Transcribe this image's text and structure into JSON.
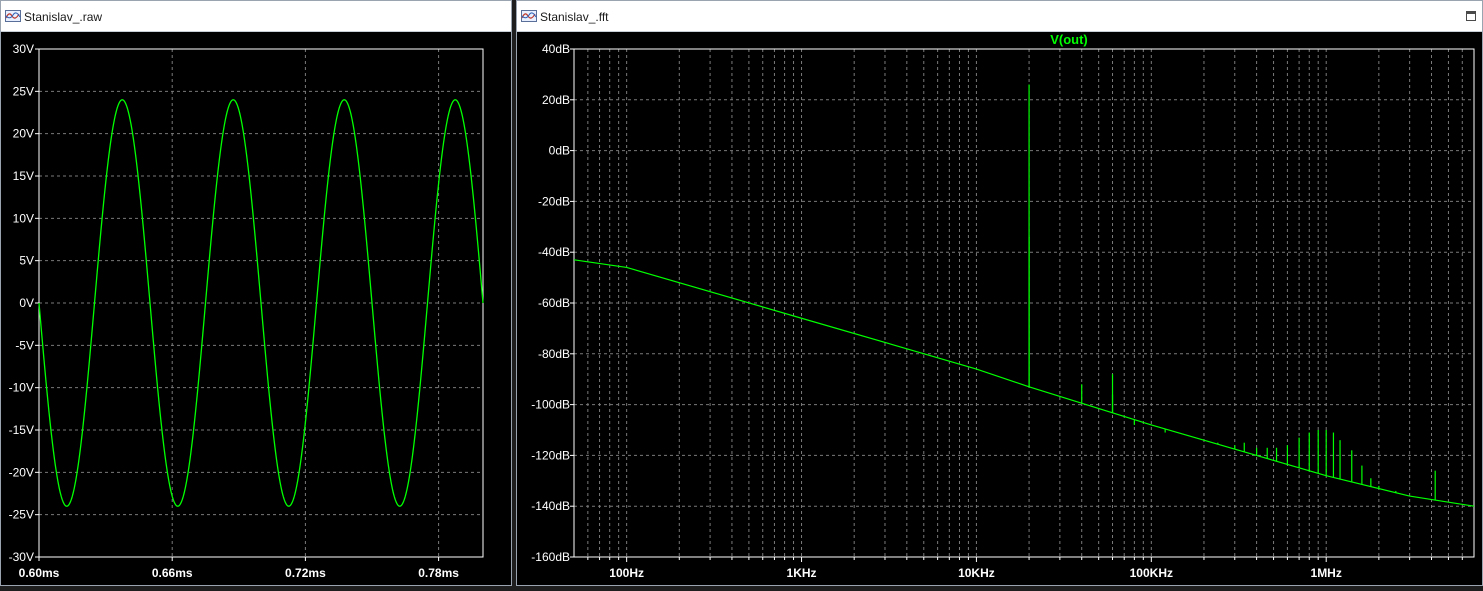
{
  "windows": {
    "left": {
      "title": "Stanislav_.raw"
    },
    "right": {
      "title": "Stanislav_.fft"
    }
  },
  "colors": {
    "trace": "#00ff00",
    "title_trace": "#00ff00",
    "axis_text": "#ffffff",
    "grid": "#7a7a7a",
    "background": "#000000"
  },
  "icons": {
    "window": "waveform-icon",
    "right_button": "maximize-icon"
  },
  "chart_data": [
    {
      "type": "line",
      "title": "",
      "xlabel": "",
      "ylabel": "",
      "xlim": [
        0.6,
        0.8
      ],
      "ylim": [
        -30,
        30
      ],
      "grid": true,
      "x_ticks": [
        0.6,
        0.66,
        0.72,
        0.78
      ],
      "x_tick_labels": [
        "0.60ms",
        "0.66ms",
        "0.72ms",
        "0.78ms"
      ],
      "y_ticks": [
        30,
        25,
        20,
        15,
        10,
        5,
        0,
        -5,
        -10,
        -15,
        -20,
        -25,
        -30
      ],
      "y_tick_labels": [
        "30V",
        "25V",
        "20V",
        "15V",
        "10V",
        "5V",
        "0V",
        "-5V",
        "-10V",
        "-15V",
        "-20V",
        "-25V",
        "-30V"
      ],
      "series": [
        {
          "amplitude": 24,
          "frequency_khz": 20,
          "phase_at_0_60ms": 0,
          "x_start": 0.6,
          "x_end": 0.8
        }
      ]
    },
    {
      "type": "line",
      "title": "V(out)",
      "xlabel": "",
      "ylabel": "",
      "xscale": "log",
      "xlim": [
        50,
        7000000
      ],
      "ylim": [
        -160,
        40
      ],
      "grid": true,
      "x_ticks": [
        100,
        1000,
        10000,
        100000,
        1000000
      ],
      "x_tick_labels": [
        "100Hz",
        "1KHz",
        "10KHz",
        "100KHz",
        "1MHz"
      ],
      "y_ticks": [
        40,
        20,
        0,
        -20,
        -40,
        -60,
        -80,
        -100,
        -120,
        -140,
        -160
      ],
      "y_tick_labels": [
        "40dB",
        "20dB",
        "0dB",
        "-20dB",
        "-40dB",
        "-60dB",
        "-80dB",
        "-100dB",
        "-120dB",
        "-140dB",
        "-160dB"
      ],
      "series": [
        {
          "name": "V(out)",
          "noise_floor": [
            [
              50,
              -43
            ],
            [
              100,
              -46
            ],
            [
              1000,
              -66
            ],
            [
              10000,
              -86
            ],
            [
              20000,
              -93
            ],
            [
              100000,
              -108
            ],
            [
              1000000,
              -128
            ],
            [
              3000000,
              -136
            ],
            [
              7000000,
              -140
            ]
          ],
          "peaks": [
            [
              20000,
              26
            ],
            [
              20000,
              -34
            ],
            [
              40000,
              -92
            ],
            [
              60000,
              -88
            ],
            [
              60000,
              -96
            ],
            [
              80000,
              -108
            ],
            [
              120000,
              -111
            ],
            [
              160000,
              -112
            ],
            [
              200000,
              -114
            ],
            [
              240000,
              -115
            ],
            [
              300000,
              -116
            ],
            [
              340000,
              -115
            ],
            [
              400000,
              -117
            ],
            [
              460000,
              -117
            ],
            [
              520000,
              -117
            ],
            [
              600000,
              -116
            ],
            [
              700000,
              -113
            ],
            [
              800000,
              -111
            ],
            [
              900000,
              -110
            ],
            [
              1000000,
              -110
            ],
            [
              1100000,
              -111
            ],
            [
              1200000,
              -114
            ],
            [
              1400000,
              -118
            ],
            [
              1600000,
              -124
            ],
            [
              1800000,
              -129
            ],
            [
              2000000,
              -132
            ],
            [
              2500000,
              -134
            ],
            [
              4200000,
              -126
            ]
          ]
        }
      ]
    }
  ]
}
